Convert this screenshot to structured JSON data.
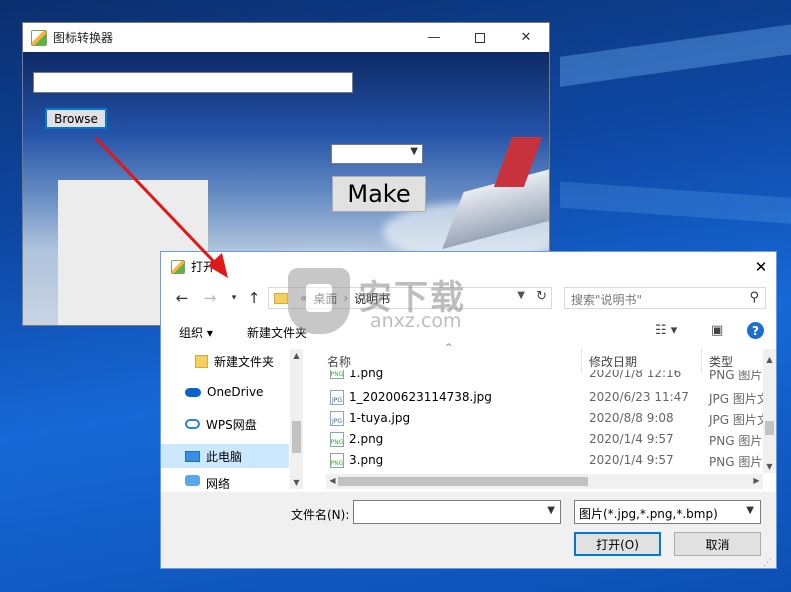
{
  "app": {
    "title": "图标转换器",
    "browse_label": "Browse",
    "make_label": "Make",
    "path_value": "",
    "size_select_value": ""
  },
  "dialog": {
    "title": "打开",
    "breadcrumb": [
      "桌面",
      "说明书"
    ],
    "search_placeholder": "搜索\"说明书\"",
    "organize_label": "组织 ▾",
    "new_folder_label": "新建文件夹",
    "nav_items": [
      {
        "label": "新建文件夹",
        "icon": "folder-icon"
      },
      {
        "label": "OneDrive",
        "icon": "onedrive-icon"
      },
      {
        "label": "WPS网盘",
        "icon": "wps-cloud-icon"
      },
      {
        "label": "此电脑",
        "icon": "computer-icon",
        "selected": true
      },
      {
        "label": "网络",
        "icon": "network-icon"
      }
    ],
    "columns": {
      "name": "名称",
      "date": "修改日期",
      "type": "类型"
    },
    "files": [
      {
        "name": "1.png",
        "date": "2020/1/8 12:16",
        "type": "PNG 图片文",
        "icon": "png"
      },
      {
        "name": "1_20200623114738.jpg",
        "date": "2020/6/23 11:47",
        "type": "JPG 图片文",
        "icon": "jpg"
      },
      {
        "name": "1-tuya.jpg",
        "date": "2020/8/8 9:08",
        "type": "JPG 图片文",
        "icon": "jpg"
      },
      {
        "name": "2.png",
        "date": "2020/1/4 9:57",
        "type": "PNG 图片文",
        "icon": "png"
      },
      {
        "name": "3.png",
        "date": "2020/1/4 9:57",
        "type": "PNG 图片文",
        "icon": "png"
      }
    ],
    "filename_label": "文件名(N):",
    "filename_value": "",
    "filter_value": "图片(*.jpg,*.png,*.bmp)",
    "open_label": "打开(O)",
    "cancel_label": "取消",
    "help_label": "?"
  },
  "watermark": {
    "title": "安下载",
    "url": "anxz.com"
  },
  "colors": {
    "accent": "#0078d7",
    "arrow": "#e01818",
    "desktop": "#1668d6"
  }
}
